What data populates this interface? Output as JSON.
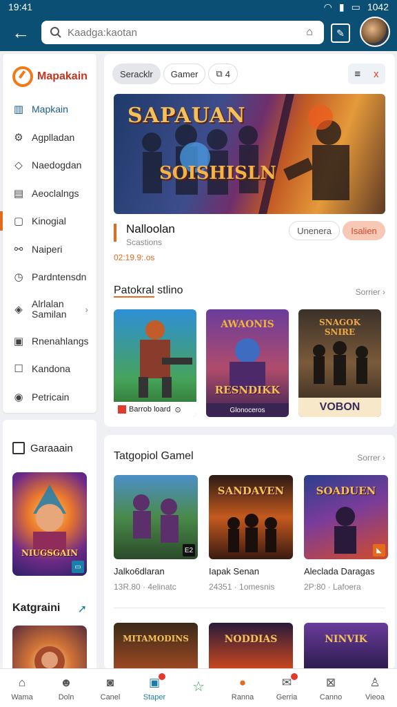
{
  "status": {
    "time": "19:41",
    "battery": "1042"
  },
  "search": {
    "placeholder": "Kaadga:kaotan"
  },
  "sidebar": {
    "brand": "Mapakain",
    "items": [
      {
        "label": "Mapkain",
        "icon": "library-icon"
      },
      {
        "label": "Agplladan",
        "icon": "settings-icon"
      },
      {
        "label": "Naedogdan",
        "icon": "tag-icon"
      },
      {
        "label": "Aeoclalngs",
        "icon": "document-icon"
      },
      {
        "label": "Kinogial",
        "icon": "folder-icon"
      },
      {
        "label": "Naiperi",
        "icon": "link-icon"
      },
      {
        "label": "Pardntensdn",
        "icon": "clock-icon"
      },
      {
        "label": "Alrlalan",
        "label2": "Samilan",
        "icon": "game-controller-icon"
      },
      {
        "label": "Rnenahlangs",
        "icon": "inbox-icon"
      },
      {
        "label": "Kandona",
        "icon": "checkbox-icon"
      },
      {
        "label": "Petricain",
        "icon": "radio-icon"
      }
    ]
  },
  "side_lower": {
    "section": "Garaaain",
    "thumb_label": "NIUGSGAIN",
    "kategori": "Katgraini"
  },
  "filters": {
    "chips": [
      "Seracklr",
      "Gamer",
      "4"
    ],
    "filter_icons": [
      "≡",
      "x"
    ]
  },
  "banner": {
    "title": "SAPAUAN",
    "subtitle": "SOISHISLN"
  },
  "promo": {
    "name": "Nalloolan",
    "meta": "Scastions",
    "price": "02:19.9:.os",
    "ghost_button": "Unenera",
    "primary_button": "Isalien"
  },
  "section1": {
    "title_a": "Patokral",
    "title_b": "stlino",
    "more": "Sorrier",
    "games": [
      {
        "caption": "Barrob loard",
        "tag": "C"
      },
      {
        "caption": "Glonoceros",
        "tag": "RESNDIKK",
        "banner": "AWAONIS"
      },
      {
        "caption": "VOBON",
        "tag": "SNAGOK SNIRE"
      }
    ]
  },
  "section2": {
    "title": "Tatgopiol Gamel",
    "more": "Sorrer",
    "games": [
      {
        "name": "Jalko6dlaran",
        "meta": "13R.80 · 4elinatc",
        "tag": "E2"
      },
      {
        "name": "Iapak Senan",
        "meta": "24351 · 1omesnis",
        "banner": "SANDAVEN"
      },
      {
        "name": "Aleclada Daragas",
        "meta": "2P:80 · Lafoera",
        "banner": "SOADUEN"
      }
    ],
    "row3": [
      "MITAMODINS",
      "NODDIAS",
      "NINVIK"
    ]
  },
  "bottom_nav": [
    {
      "label": "Wama",
      "icon": "home-icon"
    },
    {
      "label": "Doln",
      "icon": "people-icon"
    },
    {
      "label": "Canel",
      "icon": "camera-icon"
    },
    {
      "label": "Staper",
      "icon": "store-icon",
      "active": true,
      "badge": true
    },
    {
      "label": "",
      "icon": "star-icon"
    },
    {
      "label": "Ranna",
      "icon": "fire-icon"
    },
    {
      "label": "Gerria",
      "icon": "mail-icon",
      "badge": true
    },
    {
      "label": "Canno",
      "icon": "check-mail-icon"
    },
    {
      "label": "Vieoa",
      "icon": "profile-icon"
    }
  ],
  "colors": {
    "appbar": "#0b4f74",
    "accent": "#e46b1d",
    "active": "#1b7ea8"
  }
}
